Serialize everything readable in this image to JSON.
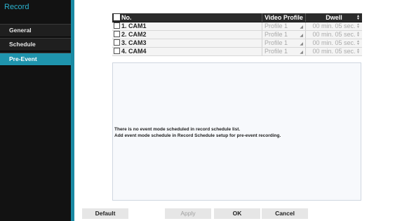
{
  "sidebar": {
    "title": "Record",
    "items": [
      {
        "label": "General",
        "active": false
      },
      {
        "label": "Schedule",
        "active": false
      },
      {
        "label": "Pre-Event",
        "active": true
      }
    ]
  },
  "table": {
    "headers": {
      "no": "No.",
      "video_profile": "Video Profile",
      "dwell": "Dwell"
    },
    "rows": [
      {
        "no": "1. CAM1",
        "video_profile": "Profile 1",
        "dwell": "00 min. 05 sec."
      },
      {
        "no": "2. CAM2",
        "video_profile": "Profile 1",
        "dwell": "00 min. 05 sec."
      },
      {
        "no": "3. CAM3",
        "video_profile": "Profile 1",
        "dwell": "00 min. 05 sec."
      },
      {
        "no": "4. CAM4",
        "video_profile": "Profile 1",
        "dwell": "00 min. 05 sec."
      }
    ]
  },
  "message": {
    "line1": "There is no event mode scheduled in record schedule list.",
    "line2": "Add event mode schedule in Record Schedule setup for pre-event recording."
  },
  "buttons": {
    "default": "Default",
    "apply": "Apply",
    "ok": "OK",
    "cancel": "Cancel"
  },
  "colors": {
    "accent": "#1f94ad",
    "title": "#2bb3cf",
    "sidebar_bg": "#121212",
    "header_bg": "#2b2b2b"
  },
  "icons": [
    "checkbox-icon",
    "dropdown-arrow-icon",
    "spinner-arrows-icon"
  ]
}
